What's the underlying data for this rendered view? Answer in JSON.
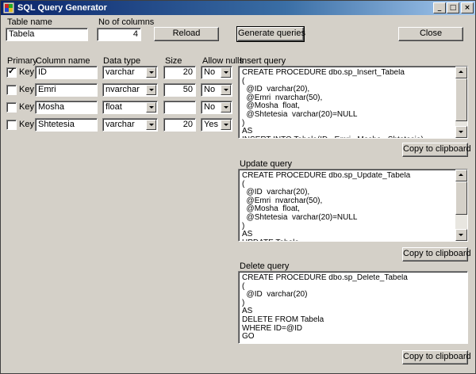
{
  "window": {
    "title": "SQL Query Generator"
  },
  "title_buttons": {
    "minimize": "_",
    "maximize": "□",
    "close": "×"
  },
  "table_name": {
    "label": "Table name",
    "value": "Tabela"
  },
  "no_columns": {
    "label": "No of columns",
    "value": "4"
  },
  "buttons": {
    "reload": "Reload",
    "generate": "Generate queries",
    "close": "Close",
    "copy_insert": "Copy to clipboard",
    "copy_update": "Copy to clipboard",
    "copy_delete": "Copy to clipboard"
  },
  "grid": {
    "headers": {
      "primary": "Primary",
      "column_name": "Column name",
      "data_type": "Data type",
      "size": "Size",
      "allow_nulls": "Allow nulls"
    },
    "key_label": "Key",
    "rows": [
      {
        "checked": true,
        "name": "ID",
        "type": "varchar",
        "size": "20",
        "nulls": "No"
      },
      {
        "checked": false,
        "name": "Emri",
        "type": "nvarchar",
        "size": "50",
        "nulls": "No"
      },
      {
        "checked": false,
        "name": "Mosha",
        "type": "float",
        "size": "",
        "nulls": "No"
      },
      {
        "checked": false,
        "name": "Shtetesia",
        "type": "varchar",
        "size": "20",
        "nulls": "Yes"
      }
    ]
  },
  "insert_query": {
    "label": "Insert query",
    "text": "CREATE PROCEDURE dbo.sp_Insert_Tabela\n(\n  @ID  varchar(20),\n  @Emri  nvarchar(50),\n  @Mosha  float,\n  @Shtetesia  varchar(20)=NULL\n)\nAS\nINSERT INTO Tabela(ID,  Emri,  Mosha,  Shtetesia)",
    "scroll_fraction": 0.9
  },
  "update_query": {
    "label": "Update query",
    "text": "CREATE PROCEDURE dbo.sp_Update_Tabela\n(\n  @ID  varchar(20),\n  @Emri  nvarchar(50),\n  @Mosha  float,\n  @Shtetesia  varchar(20)=NULL\n)\nAS\nUPDATE Tabela",
    "scroll_fraction": 0.7
  },
  "delete_query": {
    "label": "Delete query",
    "text": "CREATE PROCEDURE dbo.sp_Delete_Tabela\n(\n  @ID  varchar(20)\n)\nAS\nDELETE FROM Tabela\nWHERE ID=@ID\nGO"
  }
}
